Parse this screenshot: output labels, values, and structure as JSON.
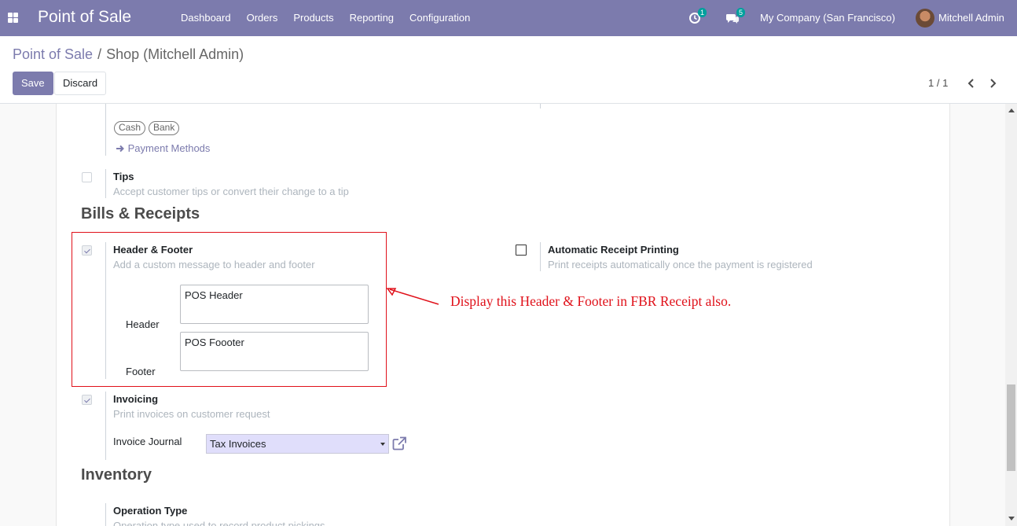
{
  "navbar": {
    "brand": "Point of Sale",
    "menu": [
      "Dashboard",
      "Orders",
      "Products",
      "Reporting",
      "Configuration"
    ],
    "activity_count": "1",
    "messages_count": "5",
    "company": "My Company (San Francisco)",
    "user": "Mitchell Admin",
    "accent_color": "#7c7bad"
  },
  "breadcrumb": {
    "parent": "Point of Sale",
    "separator": "/",
    "current": "Shop (Mitchell Admin)"
  },
  "buttons": {
    "save": "Save",
    "discard": "Discard"
  },
  "pager": {
    "value": "1 / 1"
  },
  "payments": {
    "chips": [
      "Cash",
      "Bank"
    ],
    "link": "Payment Methods"
  },
  "tips": {
    "title": "Tips",
    "description": "Accept customer tips or convert their change to a tip",
    "checked": false
  },
  "sections": {
    "bills": "Bills & Receipts",
    "inventory": "Inventory"
  },
  "header_footer": {
    "title": "Header & Footer",
    "description": "Add a custom message to header and footer",
    "checked": true,
    "header_label": "Header",
    "header_value": "POS Header",
    "footer_label": "Footer",
    "footer_value": "POS Foooter"
  },
  "auto_receipt": {
    "title": "Automatic Receipt Printing",
    "description": "Print receipts automatically once the payment is registered",
    "checked": false
  },
  "annotation": {
    "text": "Display this Header & Footer in FBR Receipt also.",
    "color": "#e0111a"
  },
  "invoicing": {
    "title": "Invoicing",
    "description": "Print invoices on customer request",
    "checked": true,
    "journal_label": "Invoice Journal",
    "journal_value": "Tax Invoices"
  },
  "operation_type": {
    "title": "Operation Type",
    "description": "Operation type used to record product pickings"
  }
}
